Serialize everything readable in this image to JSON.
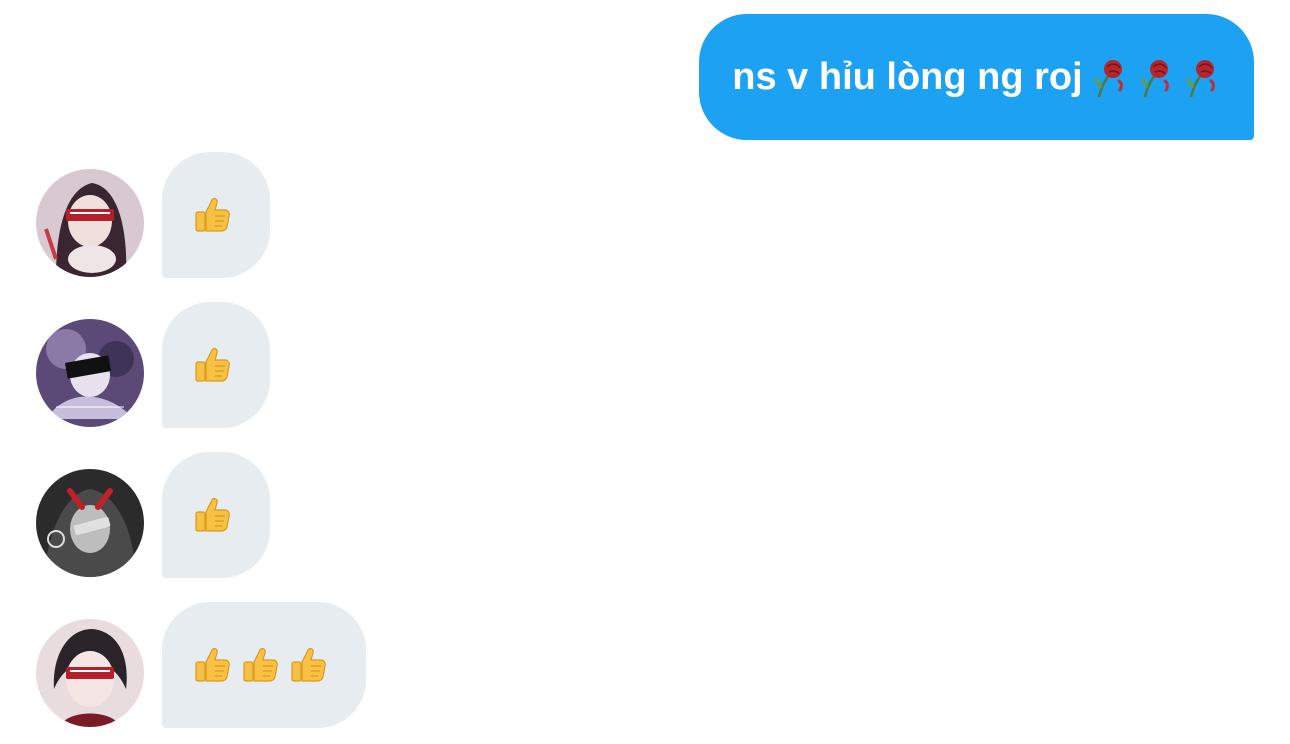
{
  "conversation": {
    "outgoing": {
      "text": "ns v hỉu lòng ng roj",
      "emoji_icons": [
        "wilted-rose-icon",
        "wilted-rose-icon",
        "wilted-rose-icon"
      ]
    },
    "incoming": [
      {
        "avatar": "supreme-anime-girl-avatar",
        "reaction_icons": [
          "thumbs-up-icon"
        ]
      },
      {
        "avatar": "error-anime-avatar",
        "reaction_icons": [
          "thumbs-up-icon"
        ]
      },
      {
        "avatar": "dark-anime-avatar",
        "reaction_icons": [
          "thumbs-up-icon"
        ]
      },
      {
        "avatar": "supreme-anime-boy-avatar",
        "reaction_icons": [
          "thumbs-up-icon",
          "thumbs-up-icon",
          "thumbs-up-icon"
        ]
      }
    ]
  },
  "colors": {
    "outgoing_bubble": "#1da1f2",
    "incoming_bubble": "#e6ecf0",
    "outgoing_text": "#ffffff"
  }
}
